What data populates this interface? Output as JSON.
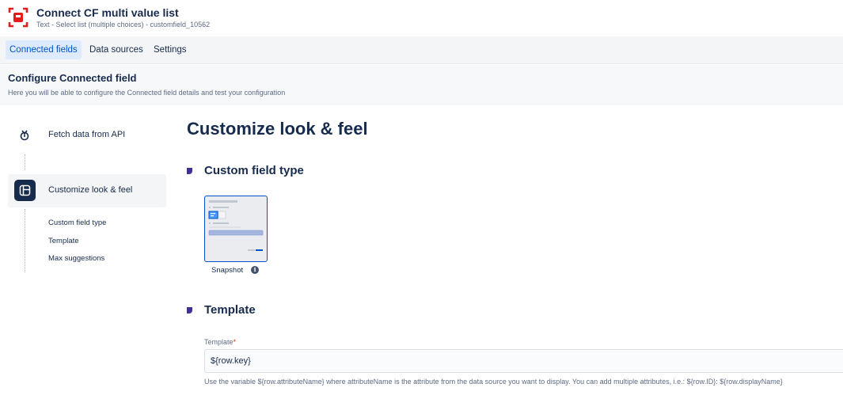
{
  "header": {
    "title": "Connect CF multi value list",
    "subtitle": "Text - Select list (multiple choices) - customfield_10562",
    "logo_icon": "connect-logo-icon",
    "brand_color": "#e01e1e"
  },
  "tabs": [
    {
      "label": "Connected fields",
      "active": true
    },
    {
      "label": "Data sources",
      "active": false
    },
    {
      "label": "Settings",
      "active": false
    }
  ],
  "config": {
    "title": "Configure Connected field",
    "description": "Here you will be able to configure the Connected field details and test your configuration"
  },
  "steps": [
    {
      "label": "Fetch data from API",
      "icon": "api-fetch-icon"
    },
    {
      "label": "Customize look & feel",
      "icon": "layout-icon",
      "active": true
    }
  ],
  "substeps": [
    "Custom field type",
    "Template",
    "Max suggestions"
  ],
  "main": {
    "title": "Customize look & feel",
    "section_type": "Custom field type",
    "type_option_label": "Snapshot",
    "section_template": "Template",
    "template_label": "Template",
    "template_value": "${row.key}",
    "template_help": "Use the variable ${row.attributeName} where attributeName is the attribute from the data source you want to display. You can add multiple attributes, i.e.: ${row.ID}: ${row.displayName}"
  },
  "colors": {
    "accent": "#0052cc",
    "section_marker": "#403294",
    "required": "#de350b"
  }
}
